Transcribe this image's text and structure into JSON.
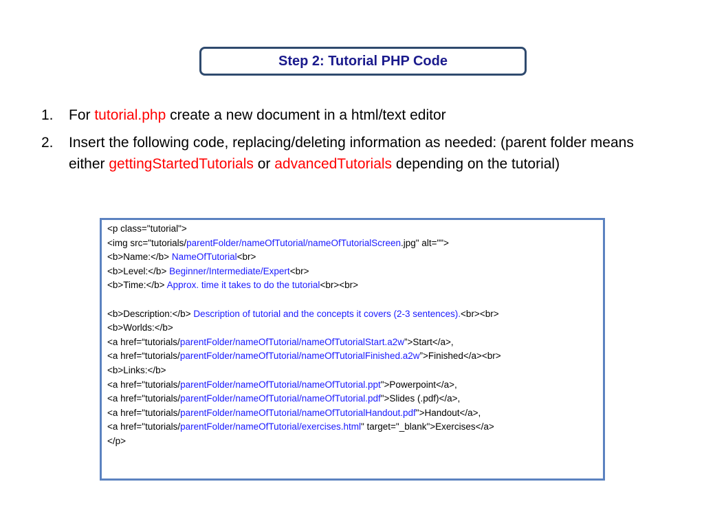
{
  "title": "Step 2: Tutorial PHP Code",
  "steps": [
    {
      "num": "1.",
      "parts": [
        {
          "text": "For ",
          "style": "normal"
        },
        {
          "text": "tutorial.php",
          "style": "red"
        },
        {
          "text": " create a new document in a html/text editor",
          "style": "normal"
        }
      ]
    },
    {
      "num": "2.",
      "parts": [
        {
          "text": "Insert the following code, replacing/deleting information as needed: (parent folder means either ",
          "style": "normal"
        },
        {
          "text": "gettingStartedTutorials",
          "style": "red"
        },
        {
          "text": " or ",
          "style": "normal"
        },
        {
          "text": "advancedTutorials",
          "style": "red"
        },
        {
          "text": " depending on the tutorial)",
          "style": "normal"
        }
      ]
    }
  ],
  "code_lines": [
    [
      {
        "text": "<p class=\"tutorial\">",
        "style": "normal"
      }
    ],
    [
      {
        "text": "<img src=\"tutorials/",
        "style": "normal"
      },
      {
        "text": "parentFolder/nameOfTutorial/nameOfTutorialScreen",
        "style": "blue"
      },
      {
        "text": ".jpg\" alt=\"\">",
        "style": "normal"
      }
    ],
    [
      {
        "text": "<b>Name:</b> ",
        "style": "normal"
      },
      {
        "text": "NameOfTutorial",
        "style": "blue"
      },
      {
        "text": "<br>",
        "style": "normal"
      }
    ],
    [
      {
        "text": "<b>Level:</b> ",
        "style": "normal"
      },
      {
        "text": "Beginner/Intermediate/Expert",
        "style": "blue"
      },
      {
        "text": "<br>",
        "style": "normal"
      }
    ],
    [
      {
        "text": "<b>Time:</b> ",
        "style": "normal"
      },
      {
        "text": "Approx. time it takes to do the tutorial",
        "style": "blue"
      },
      {
        "text": "<br><br>",
        "style": "normal"
      }
    ],
    [],
    [
      {
        "text": "<b>Description:</b> ",
        "style": "normal"
      },
      {
        "text": "Description of tutorial and the concepts it covers (2-3 sentences).",
        "style": "blue"
      },
      {
        "text": "<br><br>",
        "style": "normal"
      }
    ],
    [
      {
        "text": "<b>Worlds:</b>",
        "style": "normal"
      }
    ],
    [
      {
        "text": "<a href=“tutorials/",
        "style": "normal"
      },
      {
        "text": "parentFolder/nameOfTutorial/nameOfTutorialStart.a2w",
        "style": "blue"
      },
      {
        "text": "”>Start</a>,",
        "style": "normal"
      }
    ],
    [
      {
        "text": "<a href=“tutorials/",
        "style": "normal"
      },
      {
        "text": "parentFolder/nameOfTutorial/nameOfTutorialFinished.a2w",
        "style": "blue"
      },
      {
        "text": "”>Finished</a><br>",
        "style": "normal"
      }
    ],
    [
      {
        "text": "<b>Links:</b>",
        "style": "normal"
      }
    ],
    [
      {
        "text": "<a href=\"tutorials/",
        "style": "normal"
      },
      {
        "text": "parentFolder/nameOfTutorial/nameOfTutorial.ppt",
        "style": "blue"
      },
      {
        "text": "\">Powerpoint</a>,",
        "style": "normal"
      }
    ],
    [
      {
        "text": "<a href=\"tutorials/",
        "style": "normal"
      },
      {
        "text": "parentFolder/nameOfTutorial/nameOfTutorial.pdf",
        "style": "blue"
      },
      {
        "text": "\">Slides (.pdf)</a>,",
        "style": "normal"
      }
    ],
    [
      {
        "text": "<a href=\"tutorials/",
        "style": "normal"
      },
      {
        "text": "parentFolder/nameOfTutorial/nameOfTutorialHandout.pdf",
        "style": "blue"
      },
      {
        "text": "\">Handout</a>,",
        "style": "normal"
      }
    ],
    [
      {
        "text": "<a href=\"tutorials/",
        "style": "normal"
      },
      {
        "text": "parentFolder/nameOfTutorial/exercises.html",
        "style": "blue"
      },
      {
        "text": "\" target=\"_blank\">Exercises</a>",
        "style": "normal"
      }
    ],
    [
      {
        "text": "</p>",
        "style": "normal"
      }
    ]
  ],
  "colors": {
    "title_text": "#1a1a8c",
    "title_border": "#2f4a6e",
    "highlight_red": "#ff0000",
    "highlight_blue": "#1a1aff",
    "code_border": "#5b82c0"
  }
}
